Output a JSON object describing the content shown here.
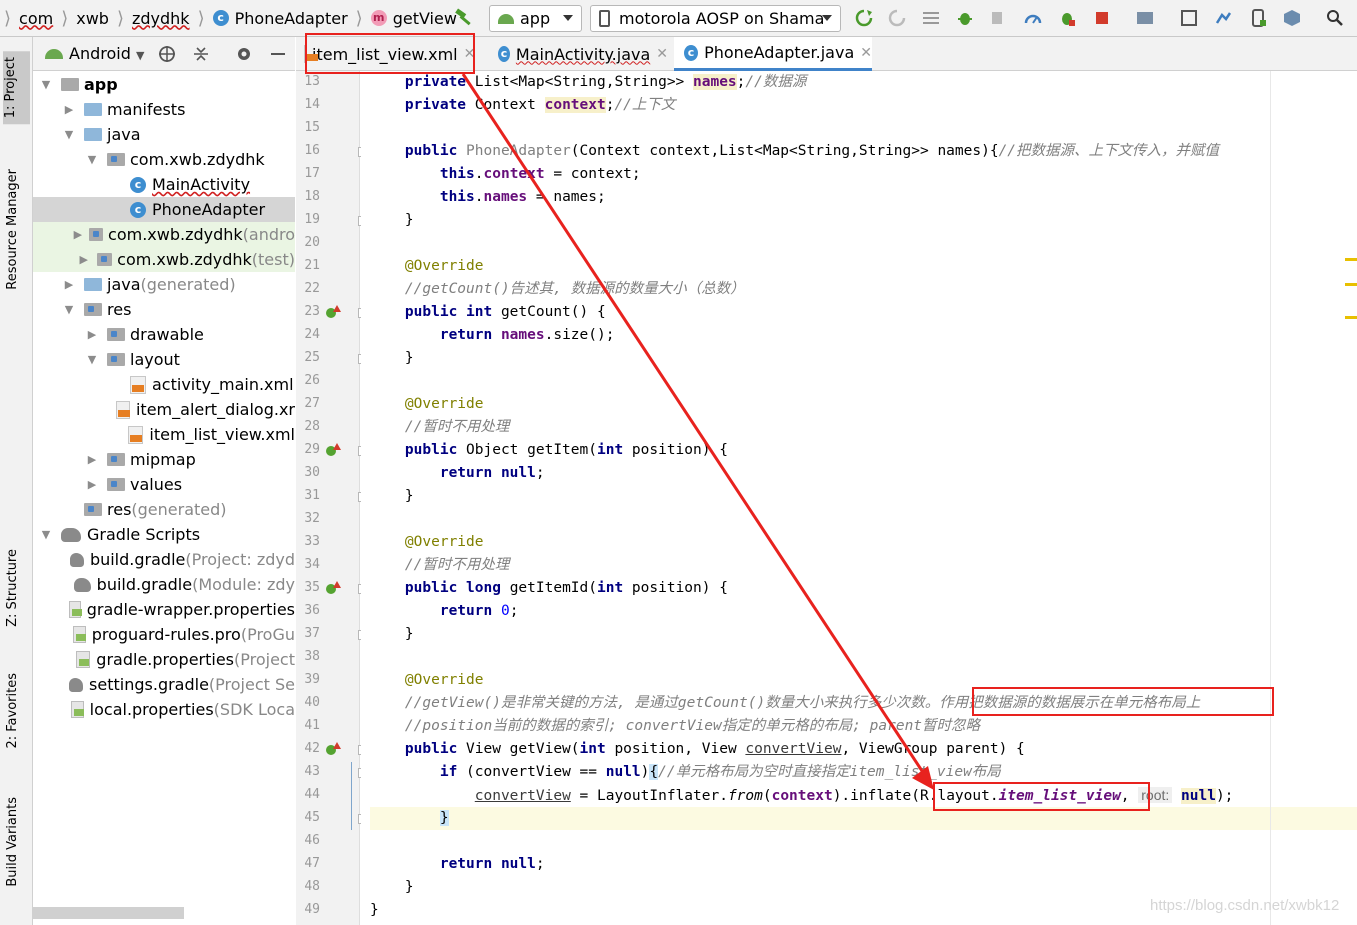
{
  "breadcrumb": [
    "com",
    "xwb",
    "zdydhk",
    "PhoneAdapter",
    "getView"
  ],
  "toolbar": {
    "run_config": "app",
    "device": "motorola AOSP on Shama"
  },
  "left_strip": [
    "1: Project",
    "Resource Manager",
    "Z: Structure",
    "2: Favorites",
    "Build Variants"
  ],
  "project_panel": {
    "view_mode": "Android",
    "tree": [
      {
        "label": "app",
        "suffix": "",
        "icon": "module-folder",
        "depth": 0,
        "expanded": true
      },
      {
        "label": "manifests",
        "suffix": "",
        "icon": "folder",
        "depth": 1,
        "expanded": false
      },
      {
        "label": "java",
        "suffix": "",
        "icon": "folder",
        "depth": 1,
        "expanded": true
      },
      {
        "label": "com.xwb.zdydhk",
        "suffix": "",
        "icon": "package",
        "depth": 2,
        "expanded": true
      },
      {
        "label": "MainActivity",
        "suffix": "",
        "icon": "class",
        "depth": 3
      },
      {
        "label": "PhoneAdapter",
        "suffix": "",
        "icon": "class",
        "depth": 3,
        "selected": true
      },
      {
        "label": "com.xwb.zdydhk",
        "suffix": " (andro",
        "icon": "package",
        "depth": 2,
        "expanded": false,
        "test": true
      },
      {
        "label": "com.xwb.zdydhk",
        "suffix": " (test)",
        "icon": "package",
        "depth": 2,
        "expanded": false,
        "test": true
      },
      {
        "label": "java",
        "suffix": " (generated)",
        "icon": "folder-gen",
        "depth": 1,
        "expanded": false
      },
      {
        "label": "res",
        "suffix": "",
        "icon": "folder-res",
        "depth": 1,
        "expanded": true
      },
      {
        "label": "drawable",
        "suffix": "",
        "icon": "folder-gray",
        "depth": 2,
        "expanded": false
      },
      {
        "label": "layout",
        "suffix": "",
        "icon": "folder-gray",
        "depth": 2,
        "expanded": true
      },
      {
        "label": "activity_main.xml",
        "suffix": "",
        "icon": "xml",
        "depth": 3
      },
      {
        "label": "item_alert_dialog.xr",
        "suffix": "",
        "icon": "xml",
        "depth": 3
      },
      {
        "label": "item_list_view.xml",
        "suffix": "",
        "icon": "xml",
        "depth": 3
      },
      {
        "label": "mipmap",
        "suffix": "",
        "icon": "folder-gray",
        "depth": 2,
        "expanded": false
      },
      {
        "label": "values",
        "suffix": "",
        "icon": "folder-gray",
        "depth": 2,
        "expanded": false
      },
      {
        "label": "res",
        "suffix": " (generated)",
        "icon": "folder-gray",
        "depth": 1
      },
      {
        "label": "Gradle Scripts",
        "suffix": "",
        "icon": "gradle",
        "depth": 0,
        "expanded": true
      },
      {
        "label": "build.gradle",
        "suffix": " (Project: zdyd",
        "icon": "gradle",
        "depth": 1
      },
      {
        "label": "build.gradle",
        "suffix": " (Module: zdy",
        "icon": "gradle",
        "depth": 1
      },
      {
        "label": "gradle-wrapper.properties",
        "suffix": "",
        "icon": "props",
        "depth": 1
      },
      {
        "label": "proguard-rules.pro",
        "suffix": " (ProGu",
        "icon": "props",
        "depth": 1
      },
      {
        "label": "gradle.properties",
        "suffix": " (Project",
        "icon": "props",
        "depth": 1
      },
      {
        "label": "settings.gradle",
        "suffix": " (Project Se",
        "icon": "gradle",
        "depth": 1
      },
      {
        "label": "local.properties",
        "suffix": " (SDK Loca",
        "icon": "props",
        "depth": 1
      }
    ]
  },
  "editor_tabs": [
    {
      "label": "item_list_view.xml",
      "active": false
    },
    {
      "label": "MainActivity.java",
      "active": false
    },
    {
      "label": "PhoneAdapter.java",
      "active": true
    }
  ],
  "code": {
    "first_line": 13,
    "lines": [
      [
        [
          "    ",
          ""
        ],
        [
          "private ",
          "kw"
        ],
        [
          "List<Map<String,String>> ",
          ""
        ],
        [
          "names",
          "fldb"
        ],
        [
          ";",
          ""
        ],
        [
          "//数据源",
          "cm"
        ]
      ],
      [
        [
          "    ",
          ""
        ],
        [
          "private ",
          "kw"
        ],
        [
          "Context ",
          ""
        ],
        [
          "context",
          "fldb"
        ],
        [
          ";",
          ""
        ],
        [
          "//上下文",
          "cm"
        ]
      ],
      [],
      [
        [
          "    ",
          ""
        ],
        [
          "public ",
          "kw"
        ],
        [
          "PhoneAdapter",
          "gr"
        ],
        [
          "(Context context,List<Map<String,String>> names){",
          ""
        ],
        [
          "//把数据源、上下文传入，并赋值",
          "cm"
        ]
      ],
      [
        [
          "        ",
          ""
        ],
        [
          "this",
          "kw"
        ],
        [
          ".",
          ""
        ],
        [
          "context",
          "fld"
        ],
        [
          " = context;",
          ""
        ]
      ],
      [
        [
          "        ",
          ""
        ],
        [
          "this",
          "kw"
        ],
        [
          ".",
          ""
        ],
        [
          "names",
          "fld"
        ],
        [
          " = names;",
          ""
        ]
      ],
      [
        [
          "    }",
          ""
        ]
      ],
      [],
      [
        [
          "    ",
          ""
        ],
        [
          "@Override",
          "ann"
        ]
      ],
      [
        [
          "    ",
          ""
        ],
        [
          "//getCount()告述其, 数据源的数量大小（总数）",
          "cm"
        ]
      ],
      [
        [
          "    ",
          ""
        ],
        [
          "public ",
          "kw"
        ],
        [
          "int ",
          "kw"
        ],
        [
          "getCount() {",
          ""
        ]
      ],
      [
        [
          "        ",
          ""
        ],
        [
          "return ",
          "kw"
        ],
        [
          "names",
          "fld"
        ],
        [
          ".size();",
          ""
        ]
      ],
      [
        [
          "    }",
          ""
        ]
      ],
      [],
      [
        [
          "    ",
          ""
        ],
        [
          "@Override",
          "ann"
        ]
      ],
      [
        [
          "    ",
          ""
        ],
        [
          "//暂时不用处理",
          "cm"
        ]
      ],
      [
        [
          "    ",
          ""
        ],
        [
          "public ",
          "kw"
        ],
        [
          "Object getItem(",
          ""
        ],
        [
          "int ",
          "kw"
        ],
        [
          "position) {",
          ""
        ]
      ],
      [
        [
          "        ",
          ""
        ],
        [
          "return ",
          "kw"
        ],
        [
          "null",
          "kw"
        ],
        [
          ";",
          ""
        ]
      ],
      [
        [
          "    }",
          ""
        ]
      ],
      [],
      [
        [
          "    ",
          ""
        ],
        [
          "@Override",
          "ann"
        ]
      ],
      [
        [
          "    ",
          ""
        ],
        [
          "//暂时不用处理",
          "cm"
        ]
      ],
      [
        [
          "    ",
          ""
        ],
        [
          "public ",
          "kw"
        ],
        [
          "long ",
          "kw"
        ],
        [
          "getItemId(",
          ""
        ],
        [
          "int ",
          "kw"
        ],
        [
          "position) {",
          ""
        ]
      ],
      [
        [
          "        ",
          ""
        ],
        [
          "return ",
          "kw"
        ],
        [
          "0",
          "num"
        ],
        [
          ";",
          ""
        ]
      ],
      [
        [
          "    }",
          ""
        ]
      ],
      [],
      [
        [
          "    ",
          ""
        ],
        [
          "@Override",
          "ann"
        ]
      ],
      [
        [
          "    ",
          ""
        ],
        [
          "//getView()是非常关键的方法, 是通过getCount()数量大小来执行多少次数。作用把数据源的数据展示在单元格布局上",
          "cm"
        ]
      ],
      [
        [
          "    ",
          ""
        ],
        [
          "//position当前的数据的索引; convertView指定的单元格的布局; parent暂时忽略",
          "cm"
        ]
      ],
      [
        [
          "    ",
          ""
        ],
        [
          "public ",
          "kw"
        ],
        [
          "View getView(",
          ""
        ],
        [
          "int ",
          "kw"
        ],
        [
          "position, View ",
          ""
        ],
        [
          "convertView",
          "ulv"
        ],
        [
          ", ViewGroup parent) {",
          ""
        ]
      ],
      [
        [
          "        ",
          ""
        ],
        [
          "if ",
          "kw"
        ],
        [
          "(convertView == ",
          ""
        ],
        [
          "null",
          "kw"
        ],
        [
          ")",
          ""
        ],
        [
          "{",
          "bracket"
        ],
        [
          "//单元格布局为空时直接指定item_list_view布局",
          "cm"
        ]
      ],
      [
        [
          "            ",
          ""
        ],
        [
          "convertView",
          "ulv"
        ],
        [
          " = LayoutInflater.",
          ""
        ],
        [
          "from",
          "ital"
        ],
        [
          "(",
          ""
        ],
        [
          "context",
          "fld"
        ],
        [
          ").inflate(R.layout.",
          ""
        ],
        [
          "item_list_view",
          "fld ital"
        ],
        [
          ", ",
          ""
        ],
        [
          "root:",
          "hint"
        ],
        [
          " ",
          ""
        ],
        [
          "null",
          "kw nullh"
        ],
        [
          ");",
          ""
        ]
      ],
      [
        [
          "        ",
          ""
        ],
        [
          "}",
          "bracket"
        ]
      ],
      [],
      [
        [
          "        ",
          ""
        ],
        [
          "return ",
          "kw"
        ],
        [
          "null",
          "kw"
        ],
        [
          ";",
          ""
        ]
      ],
      [
        [
          "    }",
          ""
        ]
      ],
      [
        [
          "}",
          ""
        ]
      ]
    ],
    "current_line": 45,
    "gutter_markers": [
      23,
      29,
      35,
      42
    ],
    "fold_markers": [
      16,
      19,
      23,
      25,
      29,
      31,
      35,
      37,
      42,
      43,
      45
    ]
  },
  "watermark": "https://blog.csdn.net/xwbk12",
  "colors": {
    "keyword": "#000080",
    "field": "#660e7a",
    "comment": "#808080",
    "annotation": "#808000",
    "number": "#0000ff",
    "annotation_box": "#e8221e"
  }
}
